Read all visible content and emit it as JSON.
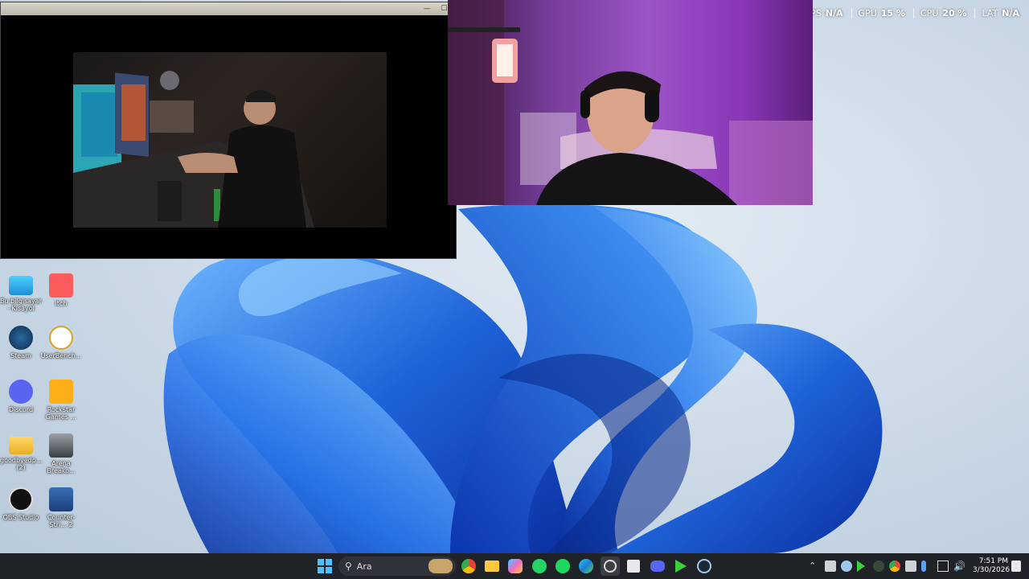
{
  "hud": {
    "fps_label": "FPS",
    "fps_value": "N/A",
    "gpu_label": "GPU",
    "gpu_value": "15 %",
    "cpu_label": "CPU",
    "cpu_value": "20 %",
    "lat_label": "LAT",
    "lat_value": "N/A"
  },
  "video_window": {
    "minimize": "—",
    "maximize": "☐"
  },
  "desktop_icons": [
    {
      "label": "Bu bilgisayar - Kısayol",
      "icon": "computer-icon"
    },
    {
      "label": "itch",
      "icon": "itch-icon"
    },
    {
      "label": "Steam",
      "icon": "steam-icon"
    },
    {
      "label": "UserBench...",
      "icon": "userbenchmark-icon"
    },
    {
      "label": "Discord",
      "icon": "discord-icon"
    },
    {
      "label": "Rockstar Games ...",
      "icon": "rockstar-icon"
    },
    {
      "label": "goodbyedp... (2)",
      "icon": "folder-icon"
    },
    {
      "label": "Arena Breako...",
      "icon": "arena-breakout-icon"
    },
    {
      "label": "OBS Studio",
      "icon": "obs-icon"
    },
    {
      "label": "Counter-Stri... 2",
      "icon": "counter-strike-icon"
    }
  ],
  "taskbar": {
    "search_placeholder": "Ara",
    "apps": [
      "start-icon",
      "chrome-icon",
      "file-explorer-icon",
      "copilot-icon",
      "whatsapp-icon",
      "spotify-icon",
      "edge-icon",
      "obs-icon",
      "store-icon",
      "discord-icon",
      "game-launcher-icon",
      "steam-icon"
    ],
    "clock_time": "7:51 PM",
    "clock_date": "3/30/2026"
  },
  "colors": {
    "taskbar": "#1f2227",
    "accent": "#1e63d8"
  }
}
